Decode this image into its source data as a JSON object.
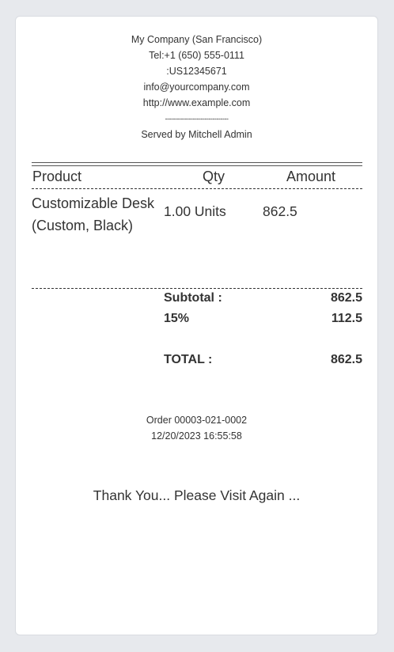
{
  "header": {
    "company": "My Company (San Francisco)",
    "phone": "Tel:+1 (650) 555-0111",
    "vat": ":US12345671",
    "email": "info@yourcompany.com",
    "website": "http://www.example.com",
    "separator": "--------------------------------",
    "served_by": "Served by Mitchell Admin"
  },
  "table": {
    "headers": {
      "product": "Product",
      "qty": "Qty",
      "amount": "Amount"
    },
    "rows": [
      {
        "product": "Customizable Desk (Custom, Black)",
        "qty": "1.00 Units",
        "amount": "862.5"
      }
    ]
  },
  "totals": {
    "subtotal_label": "Subtotal :",
    "subtotal_value": "862.5",
    "tax_label": "15%",
    "tax_value": "112.5",
    "total_label": "TOTAL :",
    "total_value": "862.5"
  },
  "order": {
    "reference": "Order 00003-021-0002",
    "datetime": "12/20/2023 16:55:58"
  },
  "footer": {
    "thanks": "Thank You... Please Visit Again ..."
  }
}
